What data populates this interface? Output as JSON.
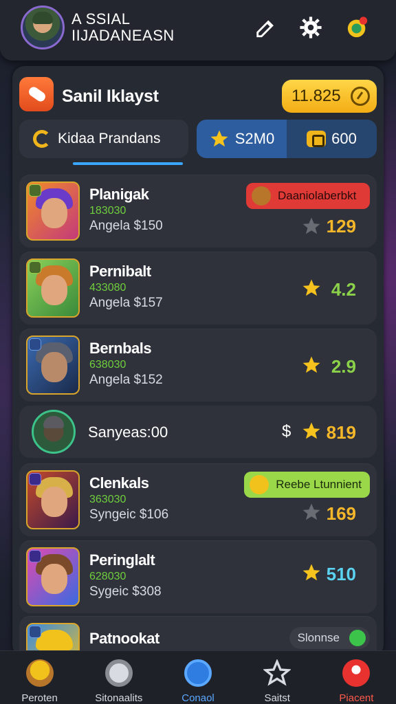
{
  "header": {
    "profile_name": "A SSIAL IIJADANEASN",
    "share_icon": "pencil-icon",
    "settings_icon": "gear-icon",
    "notify_icon": "notification-icon"
  },
  "app": {
    "title": "Sanil Iklayst",
    "coins": "11.825"
  },
  "tabs": {
    "main_label": "Kidaa Prandans",
    "stat_a": "S2M0",
    "stat_b": "600"
  },
  "players": [
    {
      "name": "Planigak",
      "code": "183030",
      "sub": "Angela $150",
      "score": "129",
      "tag": "Daaniolaberbkt",
      "star": "gray"
    },
    {
      "name": "Pernibalt",
      "code": "433080",
      "sub": "Angela $157",
      "score": "4.2",
      "star": "gold"
    },
    {
      "name": "Bernbals",
      "code": "638030",
      "sub": "Angela $152",
      "score": "2.9",
      "star": "gold"
    }
  ],
  "summary": {
    "text": "Sanyeas:00",
    "dollar": "$",
    "score": "819"
  },
  "players2": [
    {
      "name": "Clenkals",
      "code": "363030",
      "sub": "Syngeic $106",
      "score": "169",
      "tag": "Reebe Ltunnient",
      "star": "gray"
    },
    {
      "name": "Peringlalt",
      "code": "628030",
      "sub": "Sygeic $308",
      "score": "510",
      "star": "gold"
    },
    {
      "name": "Patnookat",
      "tag": "Slonnse"
    }
  ],
  "nav": [
    {
      "label": "Peroten",
      "icon": "hero-icon"
    },
    {
      "label": "Sitonaalits",
      "icon": "heart-icon"
    },
    {
      "label": "Conaol",
      "icon": "home-icon"
    },
    {
      "label": "Saitst",
      "icon": "star-icon"
    },
    {
      "label": "Piacent",
      "icon": "profile-icon"
    }
  ],
  "colors": {
    "accent": "#3aa6ff",
    "gold": "#f1b51c",
    "green": "#6fcf3c",
    "red": "#e8322f"
  }
}
